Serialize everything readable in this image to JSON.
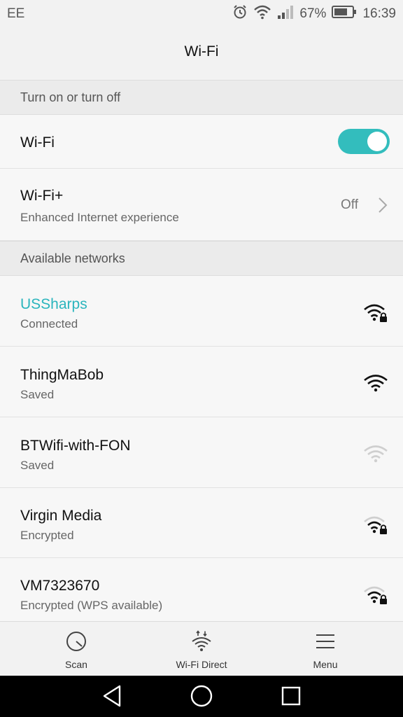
{
  "status": {
    "carrier": "EE",
    "battery": "67%",
    "time": "16:39"
  },
  "header": {
    "title": "Wi-Fi"
  },
  "section_toggle": {
    "label": "Turn on or turn off"
  },
  "wifi_row": {
    "label": "Wi-Fi",
    "enabled": true
  },
  "wifi_plus": {
    "label": "Wi-Fi+",
    "subtitle": "Enhanced Internet experience",
    "state": "Off"
  },
  "section_networks": {
    "label": "Available networks"
  },
  "networks": [
    {
      "name": "USSharps",
      "status": "Connected",
      "secured": true,
      "strength": "full",
      "connected": true
    },
    {
      "name": "ThingMaBob",
      "status": "Saved",
      "secured": false,
      "strength": "full",
      "connected": false
    },
    {
      "name": "BTWifi-with-FON",
      "status": "Saved",
      "secured": false,
      "strength": "weak",
      "connected": false
    },
    {
      "name": "Virgin Media",
      "status": "Encrypted",
      "secured": true,
      "strength": "medium",
      "connected": false
    },
    {
      "name": "VM7323670",
      "status": "Encrypted (WPS available)",
      "secured": true,
      "strength": "medium",
      "connected": false
    }
  ],
  "actions": {
    "scan": "Scan",
    "wifi_direct": "Wi-Fi Direct",
    "menu": "Menu"
  },
  "colors": {
    "accent": "#33bdbd",
    "connected_text": "#2bb5bd"
  }
}
